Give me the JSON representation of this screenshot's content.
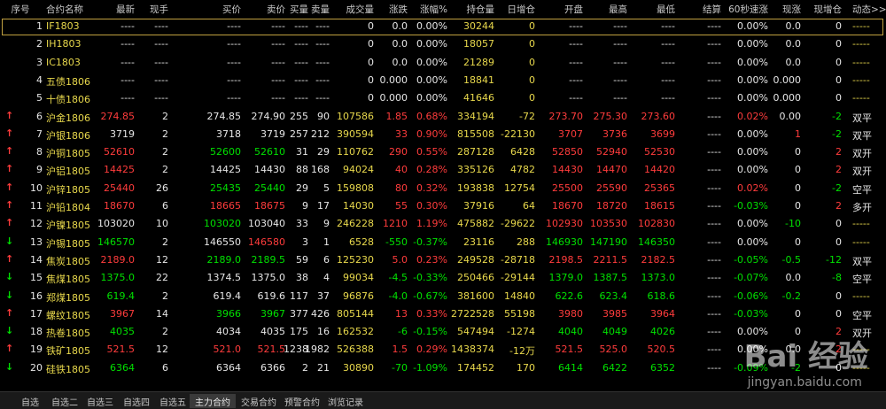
{
  "header": [
    "序号",
    "合约名称",
    "最新",
    "现手",
    "买价",
    "卖价",
    "买量",
    "卖量",
    "成交量",
    "涨跌",
    "涨幅%",
    "持仓量",
    "日增仓",
    "开盘",
    "最高",
    "最低",
    "结算",
    "60秒速涨",
    "现涨",
    "现增仓",
    "动态>>"
  ],
  "rows": [
    {
      "arrow": "",
      "cols": [
        "1",
        "IF1803",
        "----",
        "----",
        "----",
        "----",
        "----",
        "----",
        "0",
        "0.0",
        "0.00%",
        "30244",
        "0",
        "----",
        "----",
        "----",
        "----",
        "0.00%",
        "0.0",
        "0",
        "-----"
      ],
      "colors": [
        "w",
        "y",
        "w",
        "w",
        "w",
        "w",
        "w",
        "w",
        "w",
        "w",
        "w",
        "y",
        "y",
        "w",
        "w",
        "w",
        "w",
        "w",
        "w",
        "w",
        "y"
      ]
    },
    {
      "arrow": "",
      "cols": [
        "2",
        "IH1803",
        "----",
        "----",
        "----",
        "----",
        "----",
        "----",
        "0",
        "0.0",
        "0.00%",
        "18057",
        "0",
        "----",
        "----",
        "----",
        "----",
        "0.00%",
        "0.0",
        "0",
        "-----"
      ],
      "colors": [
        "w",
        "y",
        "w",
        "w",
        "w",
        "w",
        "w",
        "w",
        "w",
        "w",
        "w",
        "y",
        "y",
        "w",
        "w",
        "w",
        "w",
        "w",
        "w",
        "w",
        "y"
      ]
    },
    {
      "arrow": "",
      "cols": [
        "3",
        "IC1803",
        "----",
        "----",
        "----",
        "----",
        "----",
        "----",
        "0",
        "0.0",
        "0.00%",
        "21289",
        "0",
        "----",
        "----",
        "----",
        "----",
        "0.00%",
        "0.0",
        "0",
        "-----"
      ],
      "colors": [
        "w",
        "y",
        "w",
        "w",
        "w",
        "w",
        "w",
        "w",
        "w",
        "w",
        "w",
        "y",
        "y",
        "w",
        "w",
        "w",
        "w",
        "w",
        "w",
        "w",
        "y"
      ]
    },
    {
      "arrow": "",
      "cols": [
        "4",
        "五债1806",
        "----",
        "----",
        "----",
        "----",
        "----",
        "----",
        "0",
        "0.000",
        "0.00%",
        "18841",
        "0",
        "----",
        "----",
        "----",
        "----",
        "0.00%",
        "0.000",
        "0",
        "-----"
      ],
      "colors": [
        "w",
        "y",
        "w",
        "w",
        "w",
        "w",
        "w",
        "w",
        "w",
        "w",
        "w",
        "y",
        "y",
        "w",
        "w",
        "w",
        "w",
        "w",
        "w",
        "w",
        "y"
      ]
    },
    {
      "arrow": "",
      "cols": [
        "5",
        "十债1806",
        "----",
        "----",
        "----",
        "----",
        "----",
        "----",
        "0",
        "0.000",
        "0.00%",
        "41646",
        "0",
        "----",
        "----",
        "----",
        "----",
        "0.00%",
        "0.000",
        "0",
        "-----"
      ],
      "colors": [
        "w",
        "y",
        "w",
        "w",
        "w",
        "w",
        "w",
        "w",
        "w",
        "w",
        "w",
        "y",
        "y",
        "w",
        "w",
        "w",
        "w",
        "w",
        "w",
        "w",
        "y"
      ]
    },
    {
      "arrow": "↑",
      "acolor": "r",
      "cols": [
        "6",
        "沪金1806",
        "274.85",
        "2",
        "274.85",
        "274.90",
        "255",
        "90",
        "107586",
        "1.85",
        "0.68%",
        "334194",
        "-72",
        "273.70",
        "275.30",
        "273.60",
        "----",
        "0.02%",
        "0.00",
        "-2",
        "双平"
      ],
      "colors": [
        "w",
        "y",
        "r",
        "w",
        "w",
        "w",
        "w",
        "w",
        "y",
        "r",
        "r",
        "y",
        "y",
        "r",
        "r",
        "r",
        "w",
        "r",
        "w",
        "g",
        "w"
      ]
    },
    {
      "arrow": "↑",
      "acolor": "r",
      "cols": [
        "7",
        "沪银1806",
        "3719",
        "2",
        "3718",
        "3719",
        "257",
        "212",
        "390594",
        "33",
        "0.90%",
        "815508",
        "-22130",
        "3707",
        "3736",
        "3699",
        "----",
        "0.00%",
        "1",
        "-2",
        "双平"
      ],
      "colors": [
        "w",
        "y",
        "w",
        "w",
        "w",
        "w",
        "w",
        "w",
        "y",
        "r",
        "r",
        "y",
        "y",
        "r",
        "r",
        "r",
        "w",
        "w",
        "r",
        "g",
        "w"
      ]
    },
    {
      "arrow": "↑",
      "acolor": "r",
      "cols": [
        "8",
        "沪铜1805",
        "52610",
        "2",
        "52600",
        "52610",
        "31",
        "29",
        "110762",
        "290",
        "0.55%",
        "287128",
        "6428",
        "52850",
        "52940",
        "52530",
        "----",
        "0.00%",
        "0",
        "2",
        "双开"
      ],
      "colors": [
        "w",
        "y",
        "r",
        "w",
        "g",
        "g",
        "w",
        "w",
        "y",
        "r",
        "r",
        "y",
        "y",
        "r",
        "r",
        "r",
        "w",
        "w",
        "w",
        "r",
        "w"
      ]
    },
    {
      "arrow": "↑",
      "acolor": "r",
      "cols": [
        "9",
        "沪铝1805",
        "14425",
        "2",
        "14425",
        "14430",
        "88",
        "168",
        "94024",
        "40",
        "0.28%",
        "335126",
        "4782",
        "14430",
        "14470",
        "14420",
        "----",
        "0.00%",
        "0",
        "2",
        "双开"
      ],
      "colors": [
        "w",
        "y",
        "r",
        "w",
        "w",
        "w",
        "w",
        "w",
        "y",
        "r",
        "r",
        "y",
        "y",
        "r",
        "r",
        "r",
        "w",
        "w",
        "w",
        "r",
        "w"
      ]
    },
    {
      "arrow": "↑",
      "acolor": "r",
      "cols": [
        "10",
        "沪锌1805",
        "25440",
        "26",
        "25435",
        "25440",
        "29",
        "5",
        "159808",
        "80",
        "0.32%",
        "193838",
        "12754",
        "25500",
        "25590",
        "25365",
        "----",
        "0.02%",
        "0",
        "-2",
        "空平"
      ],
      "colors": [
        "w",
        "y",
        "r",
        "w",
        "g",
        "g",
        "w",
        "w",
        "y",
        "r",
        "r",
        "y",
        "y",
        "r",
        "r",
        "r",
        "w",
        "r",
        "w",
        "g",
        "w"
      ]
    },
    {
      "arrow": "↑",
      "acolor": "r",
      "cols": [
        "11",
        "沪铅1804",
        "18670",
        "6",
        "18665",
        "18675",
        "9",
        "17",
        "14030",
        "55",
        "0.30%",
        "37916",
        "64",
        "18670",
        "18720",
        "18615",
        "----",
        "-0.03%",
        "0",
        "2",
        "多开"
      ],
      "colors": [
        "w",
        "y",
        "r",
        "w",
        "r",
        "r",
        "w",
        "w",
        "y",
        "r",
        "r",
        "y",
        "y",
        "r",
        "r",
        "r",
        "w",
        "g",
        "w",
        "r",
        "w"
      ]
    },
    {
      "arrow": "↑",
      "acolor": "r",
      "cols": [
        "12",
        "沪镍1805",
        "103020",
        "10",
        "103020",
        "103040",
        "33",
        "9",
        "246228",
        "1210",
        "1.19%",
        "475882",
        "-29622",
        "102930",
        "103530",
        "102830",
        "----",
        "0.00%",
        "-10",
        "0",
        "-----"
      ],
      "colors": [
        "w",
        "y",
        "w",
        "w",
        "g",
        "w",
        "w",
        "w",
        "y",
        "r",
        "r",
        "y",
        "y",
        "r",
        "r",
        "r",
        "w",
        "w",
        "g",
        "w",
        "y"
      ]
    },
    {
      "arrow": "↓",
      "acolor": "g",
      "cols": [
        "13",
        "沪锡1805",
        "146570",
        "2",
        "146550",
        "146580",
        "3",
        "1",
        "6528",
        "-550",
        "-0.37%",
        "23116",
        "288",
        "146930",
        "147190",
        "146350",
        "----",
        "0.00%",
        "0",
        "0",
        "-----"
      ],
      "colors": [
        "w",
        "y",
        "g",
        "w",
        "w",
        "r",
        "w",
        "w",
        "y",
        "g",
        "g",
        "y",
        "y",
        "g",
        "g",
        "g",
        "w",
        "w",
        "w",
        "w",
        "y"
      ]
    },
    {
      "arrow": "↑",
      "acolor": "r",
      "cols": [
        "14",
        "焦炭1805",
        "2189.0",
        "12",
        "2189.0",
        "2189.5",
        "59",
        "6",
        "125230",
        "5.0",
        "0.23%",
        "249528",
        "-28718",
        "2198.5",
        "2211.5",
        "2182.5",
        "----",
        "-0.05%",
        "-0.5",
        "-12",
        "双平"
      ],
      "colors": [
        "w",
        "y",
        "r",
        "w",
        "g",
        "g",
        "w",
        "w",
        "y",
        "r",
        "r",
        "y",
        "y",
        "r",
        "r",
        "r",
        "w",
        "g",
        "g",
        "g",
        "w"
      ]
    },
    {
      "arrow": "↓",
      "acolor": "g",
      "cols": [
        "15",
        "焦煤1805",
        "1375.0",
        "22",
        "1374.5",
        "1375.0",
        "38",
        "4",
        "99034",
        "-4.5",
        "-0.33%",
        "250466",
        "-29144",
        "1379.0",
        "1387.5",
        "1373.0",
        "----",
        "-0.07%",
        "0.0",
        "-8",
        "空平"
      ],
      "colors": [
        "w",
        "y",
        "g",
        "w",
        "w",
        "w",
        "w",
        "w",
        "y",
        "g",
        "g",
        "y",
        "y",
        "g",
        "g",
        "g",
        "w",
        "g",
        "w",
        "g",
        "w"
      ]
    },
    {
      "arrow": "↓",
      "acolor": "g",
      "cols": [
        "16",
        "郑煤1805",
        "619.4",
        "2",
        "619.4",
        "619.6",
        "117",
        "37",
        "96876",
        "-4.0",
        "-0.67%",
        "381600",
        "14840",
        "622.6",
        "623.4",
        "618.6",
        "----",
        "-0.06%",
        "-0.2",
        "0",
        "-----"
      ],
      "colors": [
        "w",
        "y",
        "g",
        "w",
        "w",
        "w",
        "w",
        "w",
        "y",
        "g",
        "g",
        "y",
        "y",
        "g",
        "g",
        "g",
        "w",
        "g",
        "g",
        "w",
        "y"
      ]
    },
    {
      "arrow": "↑",
      "acolor": "r",
      "cols": [
        "17",
        "螺纹1805",
        "3967",
        "14",
        "3966",
        "3967",
        "377",
        "426",
        "805144",
        "13",
        "0.33%",
        "2722528",
        "55198",
        "3980",
        "3985",
        "3964",
        "----",
        "-0.03%",
        "0",
        "0",
        "空平"
      ],
      "colors": [
        "w",
        "y",
        "r",
        "w",
        "g",
        "g",
        "w",
        "w",
        "y",
        "r",
        "r",
        "y",
        "y",
        "r",
        "r",
        "r",
        "w",
        "g",
        "w",
        "w",
        "w"
      ]
    },
    {
      "arrow": "↓",
      "acolor": "g",
      "cols": [
        "18",
        "热卷1805",
        "4035",
        "2",
        "4034",
        "4035",
        "175",
        "16",
        "162532",
        "-6",
        "-0.15%",
        "547494",
        "-1274",
        "4040",
        "4049",
        "4026",
        "----",
        "0.00%",
        "0",
        "2",
        "双开"
      ],
      "colors": [
        "w",
        "y",
        "g",
        "w",
        "w",
        "w",
        "w",
        "w",
        "y",
        "g",
        "g",
        "y",
        "y",
        "g",
        "g",
        "g",
        "w",
        "w",
        "w",
        "r",
        "w"
      ]
    },
    {
      "arrow": "↑",
      "acolor": "r",
      "cols": [
        "19",
        "铁矿1805",
        "521.5",
        "12",
        "521.0",
        "521.5",
        "1238",
        "1982",
        "526388",
        "1.5",
        "0.29%",
        "1438374",
        "-12万",
        "521.5",
        "525.0",
        "520.5",
        "----",
        "0.00%",
        "0.0",
        "2",
        "-----"
      ],
      "colors": [
        "w",
        "y",
        "r",
        "w",
        "r",
        "r",
        "w",
        "w",
        "y",
        "r",
        "r",
        "y",
        "y",
        "r",
        "r",
        "r",
        "w",
        "w",
        "w",
        "r",
        "y"
      ]
    },
    {
      "arrow": "↓",
      "acolor": "g",
      "cols": [
        "20",
        "硅铁1805",
        "6364",
        "6",
        "6364",
        "6366",
        "2",
        "21",
        "30890",
        "-70",
        "-1.09%",
        "174452",
        "170",
        "6414",
        "6422",
        "6352",
        "----",
        "-0.09%",
        "-2",
        "0",
        "-----"
      ],
      "colors": [
        "w",
        "y",
        "g",
        "w",
        "w",
        "w",
        "w",
        "w",
        "y",
        "g",
        "g",
        "y",
        "y",
        "g",
        "g",
        "g",
        "w",
        "g",
        "g",
        "w",
        "y"
      ]
    }
  ],
  "tabs": [
    {
      "label": "自选",
      "active": false
    },
    {
      "label": "自选二",
      "active": false
    },
    {
      "label": "自选三",
      "active": false
    },
    {
      "label": "自选四",
      "active": false
    },
    {
      "label": "自选五",
      "active": false
    },
    {
      "label": "主力合约",
      "active": true
    },
    {
      "label": "交易合约",
      "active": false
    },
    {
      "label": "预警合约",
      "active": false
    },
    {
      "label": "浏览记录",
      "active": false
    }
  ],
  "watermark": {
    "brand": "Bai 经验",
    "url": "jingyan.baidu.com"
  }
}
